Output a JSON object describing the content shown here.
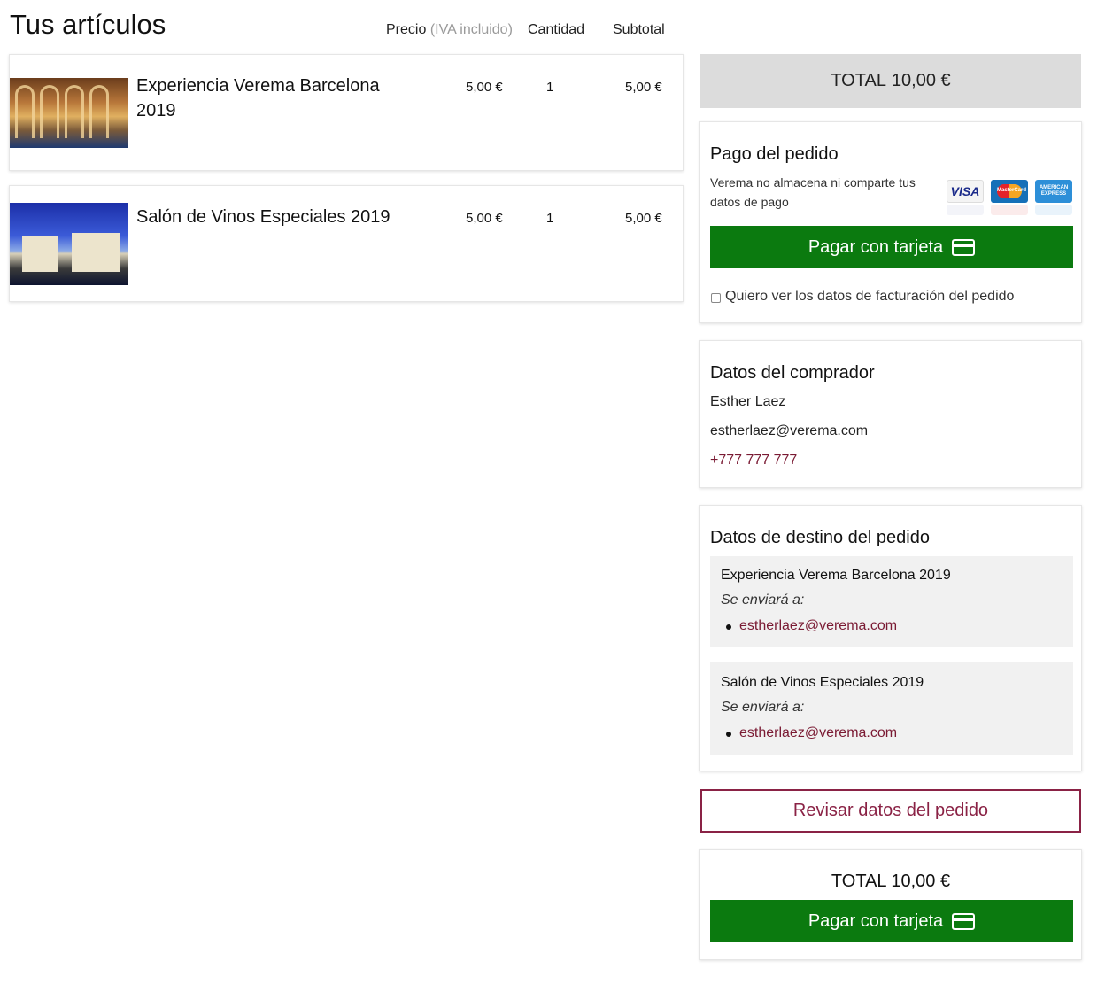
{
  "page": {
    "title": "Tus artículos"
  },
  "columns": {
    "price": "Precio",
    "price_note": "(IVA incluido)",
    "quantity": "Cantidad",
    "subtotal": "Subtotal"
  },
  "items": [
    {
      "name": "Experiencia Verema Barcelona 2019",
      "price": "5,00 €",
      "quantity": "1",
      "subtotal": "5,00 €"
    },
    {
      "name": "Salón de Vinos Especiales 2019",
      "price": "5,00 €",
      "quantity": "1",
      "subtotal": "5,00 €"
    }
  ],
  "summary": {
    "total_label": "TOTAL",
    "total_value": "10,00 €",
    "total_full": "TOTAL 10,00 €"
  },
  "payment": {
    "title": "Pago del pedido",
    "notice": "Verema no almacena ni comparte tus datos de pago",
    "pay_button": "Pagar con tarjeta",
    "billing_checkbox": "Quiero ver los datos de facturación del pedido",
    "card_logos": [
      "visa-logo",
      "mastercard-logo",
      "amex-logo"
    ],
    "card_logo_texts": {
      "visa": "VISA",
      "mastercard": "MasterCard",
      "amex": "AMERICAN EXPRESS"
    }
  },
  "buyer": {
    "title": "Datos del comprador",
    "name": "Esther Laez",
    "email": "estherlaez@verema.com",
    "phone": "+777 777 777"
  },
  "destination": {
    "title": "Datos de destino del pedido",
    "send_to_label": "Se enviará a:",
    "entries": [
      {
        "product": "Experiencia Verema Barcelona 2019",
        "email": "estherlaez@verema.com"
      },
      {
        "product": "Salón de Vinos Especiales 2019",
        "email": "estherlaez@verema.com"
      }
    ]
  },
  "actions": {
    "review_button": "Revisar datos del pedido"
  },
  "colors": {
    "pay_green": "#0b7a0f",
    "accent_burgundy": "#8a2245",
    "link_burgundy": "#7a1a33",
    "total_bg": "#dcdcdc"
  }
}
